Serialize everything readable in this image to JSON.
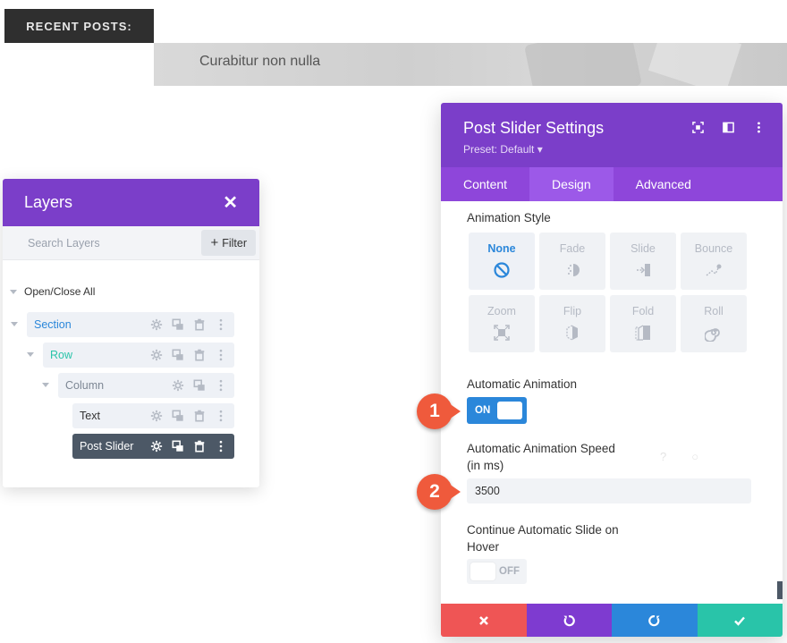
{
  "background": {
    "recent_posts_label": "RECENT POSTS:",
    "hero_title": "Curabitur non nulla"
  },
  "layers": {
    "title": "Layers",
    "close_icon": "close-icon",
    "search_placeholder": "Search Layers",
    "filter_label": "Filter",
    "open_close_label": "Open/Close All",
    "items": [
      {
        "label": "Section",
        "color": "#2b87da"
      },
      {
        "label": "Row",
        "color": "#29c4a9"
      },
      {
        "label": "Column",
        "color": "#7d8794"
      },
      {
        "label": "Text",
        "color": "#333333"
      },
      {
        "label": "Post Slider",
        "color": "#ffffff"
      }
    ]
  },
  "settings": {
    "title": "Post Slider Settings",
    "preset": "Preset: Default ▾",
    "tabs": [
      {
        "label": "Content",
        "active": false
      },
      {
        "label": "Design",
        "active": true
      },
      {
        "label": "Advanced",
        "active": false
      }
    ],
    "animation_style_label": "Animation Style",
    "animation_options": [
      {
        "label": "None",
        "icon": "ban-icon",
        "active": true
      },
      {
        "label": "Fade",
        "icon": "fade-icon",
        "active": false
      },
      {
        "label": "Slide",
        "icon": "slide-icon",
        "active": false
      },
      {
        "label": "Bounce",
        "icon": "bounce-icon",
        "active": false
      },
      {
        "label": "Zoom",
        "icon": "zoom-icon",
        "active": false
      },
      {
        "label": "Flip",
        "icon": "flip-icon",
        "active": false
      },
      {
        "label": "Fold",
        "icon": "fold-icon",
        "active": false
      },
      {
        "label": "Roll",
        "icon": "roll-icon",
        "active": false
      }
    ],
    "auto_animation_label": "Automatic Animation",
    "auto_animation_toggle": "ON",
    "speed_label_line1": "Automatic Animation Speed",
    "speed_label_line2": "(in ms)",
    "speed_value": "3500",
    "continue_label_line1": "Continue Automatic Slide on",
    "continue_label_line2": "Hover",
    "continue_toggle": "OFF"
  },
  "callouts": {
    "one": "1",
    "two": "2"
  },
  "colors": {
    "purple_header": "#7b3ec9",
    "purple_tabs": "#8e46da",
    "blue_accent": "#2b87da",
    "callout": "#ef5a3c"
  }
}
